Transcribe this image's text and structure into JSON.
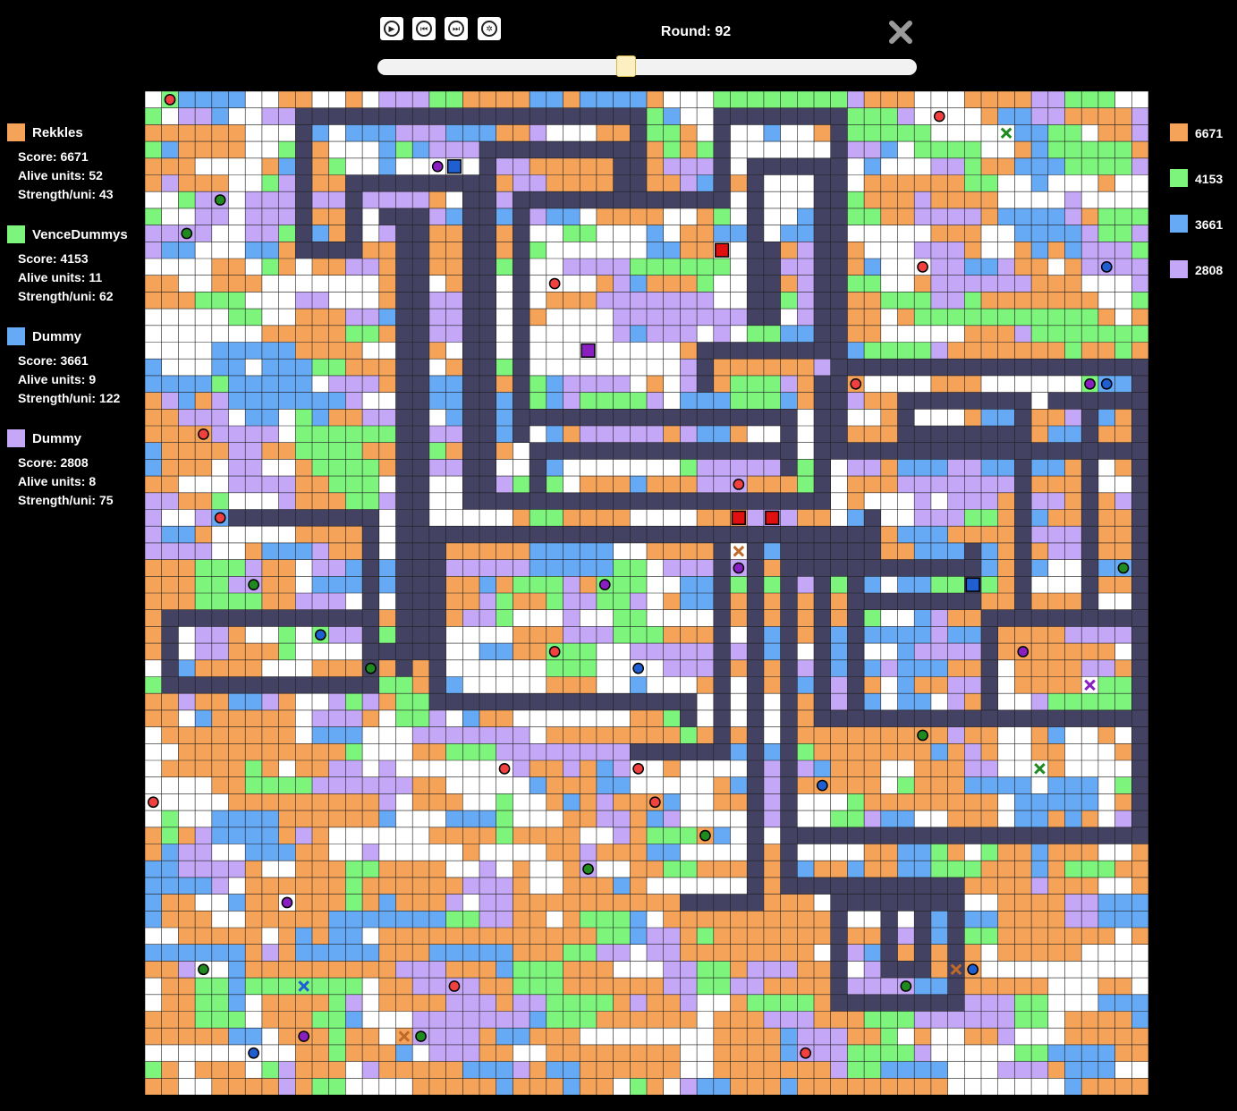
{
  "controls": [
    {
      "name": "play-button",
      "icon": "play-icon",
      "glyph": "▶"
    },
    {
      "name": "step-back-button",
      "icon": "rewind-icon",
      "glyph": "⏮"
    },
    {
      "name": "step-forward-button",
      "icon": "fast-forward-icon",
      "glyph": "⏭"
    },
    {
      "name": "settings-button",
      "icon": "gear-icon",
      "glyph": "✲"
    }
  ],
  "round_label": "Round: 92",
  "timeline": {
    "position_fraction": 0.46
  },
  "close_icon": "close-icon",
  "colors": {
    "orange": "#f6a35a",
    "green": "#7df57c",
    "blue": "#66a9f5",
    "purple": "#c4a7f7",
    "wall": "#434262",
    "empty": "#ffffff",
    "grid": "#1f1f1f"
  },
  "players": [
    {
      "name": "Rekkles",
      "color": "#f6a35a",
      "score": "Score: 6671",
      "alive": "Alive units: 52",
      "strength": "Strength/uni: 43"
    },
    {
      "name": "VenceDummys",
      "color": "#7df57c",
      "score": "Score: 4153",
      "alive": "Alive units: 11",
      "strength": "Strength/uni: 62"
    },
    {
      "name": "Dummy",
      "color": "#66a9f5",
      "score": "Score: 3661",
      "alive": "Alive units: 9",
      "strength": "Strength/uni: 122"
    },
    {
      "name": "Dummy",
      "color": "#c4a7f7",
      "score": "Score: 2808",
      "alive": "Alive units: 8",
      "strength": "Strength/uni: 75"
    }
  ],
  "scoreboard": [
    {
      "color": "#f6a35a",
      "value": "6671"
    },
    {
      "color": "#7df57c",
      "value": "4153"
    },
    {
      "color": "#66a9f5",
      "value": "3661"
    },
    {
      "color": "#c4a7f7",
      "value": "2808"
    }
  ],
  "board": {
    "grid_size": 60,
    "seed": 92,
    "walls": [
      [
        9,
        1,
        29,
        1
      ],
      [
        9,
        1,
        9,
        9
      ],
      [
        9,
        9,
        12,
        9
      ],
      [
        12,
        5,
        12,
        9
      ],
      [
        12,
        5,
        19,
        5
      ],
      [
        19,
        5,
        19,
        24
      ],
      [
        20,
        3,
        20,
        24
      ],
      [
        20,
        3,
        28,
        3
      ],
      [
        28,
        3,
        28,
        6
      ],
      [
        29,
        1,
        29,
        6
      ],
      [
        29,
        6,
        34,
        6
      ],
      [
        34,
        1,
        34,
        6
      ],
      [
        34,
        1,
        41,
        1
      ],
      [
        41,
        1,
        41,
        16
      ],
      [
        41,
        16,
        59,
        16
      ],
      [
        59,
        16,
        59,
        44
      ],
      [
        36,
        4,
        40,
        4
      ],
      [
        36,
        4,
        36,
        13
      ],
      [
        37,
        9,
        37,
        13
      ],
      [
        40,
        4,
        40,
        15
      ],
      [
        33,
        15,
        40,
        15
      ],
      [
        33,
        15,
        33,
        17
      ],
      [
        22,
        6,
        22,
        20
      ],
      [
        22,
        6,
        27,
        6
      ],
      [
        22,
        19,
        38,
        19
      ],
      [
        38,
        19,
        38,
        22
      ],
      [
        23,
        21,
        38,
        21
      ],
      [
        23,
        21,
        23,
        24
      ],
      [
        20,
        24,
        40,
        24
      ],
      [
        40,
        17,
        40,
        24
      ],
      [
        15,
        7,
        15,
        34
      ],
      [
        14,
        7,
        16,
        7
      ],
      [
        16,
        7,
        16,
        33
      ],
      [
        13,
        33,
        16,
        33
      ],
      [
        13,
        33,
        13,
        35
      ],
      [
        1,
        31,
        13,
        31
      ],
      [
        1,
        31,
        1,
        35
      ],
      [
        1,
        35,
        13,
        35
      ],
      [
        5,
        25,
        13,
        25
      ],
      [
        13,
        25,
        13,
        32
      ],
      [
        17,
        26,
        17,
        36
      ],
      [
        17,
        26,
        43,
        26
      ],
      [
        17,
        36,
        32,
        36
      ],
      [
        32,
        36,
        32,
        37
      ],
      [
        34,
        26,
        34,
        39
      ],
      [
        29,
        39,
        34,
        39
      ],
      [
        36,
        26,
        36,
        48
      ],
      [
        32,
        48,
        36,
        48
      ],
      [
        43,
        25,
        43,
        26
      ],
      [
        38,
        26,
        38,
        47
      ],
      [
        38,
        27,
        43,
        27
      ],
      [
        43,
        26,
        43,
        28
      ],
      [
        39,
        28,
        48,
        28
      ],
      [
        40,
        29,
        40,
        37
      ],
      [
        40,
        37,
        59,
        37
      ],
      [
        59,
        37,
        59,
        44
      ],
      [
        38,
        44,
        59,
        44
      ],
      [
        38,
        47,
        48,
        47
      ],
      [
        48,
        47,
        48,
        54
      ],
      [
        41,
        48,
        41,
        54
      ],
      [
        41,
        54,
        48,
        54
      ],
      [
        42,
        48,
        47,
        48
      ],
      [
        46,
        49,
        46,
        52
      ],
      [
        44,
        52,
        46,
        52
      ],
      [
        44,
        49,
        44,
        52
      ],
      [
        42,
        27,
        42,
        36
      ],
      [
        49,
        27,
        49,
        30
      ],
      [
        42,
        30,
        49,
        30
      ],
      [
        56,
        18,
        56,
        31
      ],
      [
        54,
        18,
        59,
        18
      ],
      [
        52,
        18,
        52,
        31
      ],
      [
        45,
        18,
        52,
        18
      ],
      [
        45,
        20,
        52,
        20
      ],
      [
        45,
        18,
        45,
        20
      ],
      [
        55,
        31,
        59,
        31
      ],
      [
        50,
        31,
        55,
        31
      ],
      [
        50,
        31,
        50,
        36
      ],
      [
        41,
        17,
        41,
        21
      ],
      [
        41,
        21,
        59,
        21
      ],
      [
        56,
        31,
        59,
        31
      ]
    ],
    "units": [
      {
        "x": 1,
        "y": 0,
        "color": "#f04040",
        "border": "#000"
      },
      {
        "x": 47,
        "y": 1,
        "color": "#f04040",
        "border": "#000"
      },
      {
        "x": 17,
        "y": 4,
        "color": "#8a1fc1",
        "border": "#c4a7f7"
      },
      {
        "x": 4,
        "y": 6,
        "color": "#1f8a1f",
        "border": "#7df57c"
      },
      {
        "x": 2,
        "y": 8,
        "color": "#1f8a1f",
        "border": "#7df57c"
      },
      {
        "x": 46,
        "y": 10,
        "color": "#f04040",
        "border": "#000"
      },
      {
        "x": 57,
        "y": 10,
        "color": "#1f5fd1",
        "border": "#66a9f5"
      },
      {
        "x": 24,
        "y": 11,
        "color": "#f04040",
        "border": "#000"
      },
      {
        "x": 42,
        "y": 17,
        "color": "#f04040",
        "border": "#000"
      },
      {
        "x": 56,
        "y": 17,
        "color": "#8a1fc1",
        "border": "#c4a7f7"
      },
      {
        "x": 57,
        "y": 17,
        "color": "#1f5fd1",
        "border": "#66a9f5"
      },
      {
        "x": 3,
        "y": 20,
        "color": "#f04040",
        "border": "#000"
      },
      {
        "x": 35,
        "y": 23,
        "color": "#f04040",
        "border": "#000"
      },
      {
        "x": 4,
        "y": 25,
        "color": "#f04040",
        "border": "#000"
      },
      {
        "x": 35,
        "y": 28,
        "color": "#8a1fc1",
        "border": "#c4a7f7"
      },
      {
        "x": 58,
        "y": 28,
        "color": "#1f8a1f",
        "border": "#7df57c"
      },
      {
        "x": 6,
        "y": 29,
        "color": "#1f8a1f",
        "border": "#7df57c"
      },
      {
        "x": 27,
        "y": 29,
        "color": "#8a1fc1",
        "border": "#c4a7f7"
      },
      {
        "x": 10,
        "y": 32,
        "color": "#1f5fd1",
        "border": "#66a9f5"
      },
      {
        "x": 24,
        "y": 33,
        "color": "#f04040",
        "border": "#000"
      },
      {
        "x": 52,
        "y": 33,
        "color": "#8a1fc1",
        "border": "#c4a7f7"
      },
      {
        "x": 13,
        "y": 34,
        "color": "#1f8a1f",
        "border": "#7df57c"
      },
      {
        "x": 29,
        "y": 34,
        "color": "#1f5fd1",
        "border": "#66a9f5"
      },
      {
        "x": 46,
        "y": 38,
        "color": "#1f8a1f",
        "border": "#7df57c"
      },
      {
        "x": 21,
        "y": 40,
        "color": "#f04040",
        "border": "#000"
      },
      {
        "x": 29,
        "y": 40,
        "color": "#f04040",
        "border": "#000"
      },
      {
        "x": 0,
        "y": 42,
        "color": "#f04040",
        "border": "#000"
      },
      {
        "x": 30,
        "y": 42,
        "color": "#f04040",
        "border": "#000"
      },
      {
        "x": 40,
        "y": 41,
        "color": "#1f5fd1",
        "border": "#66a9f5"
      },
      {
        "x": 33,
        "y": 44,
        "color": "#1f8a1f",
        "border": "#7df57c"
      },
      {
        "x": 26,
        "y": 46,
        "color": "#1f8a1f",
        "border": "#7df57c"
      },
      {
        "x": 8,
        "y": 48,
        "color": "#8a1fc1",
        "border": "#c4a7f7"
      },
      {
        "x": 3,
        "y": 52,
        "color": "#1f8a1f",
        "border": "#7df57c"
      },
      {
        "x": 49,
        "y": 52,
        "color": "#1f5fd1",
        "border": "#66a9f5"
      },
      {
        "x": 18,
        "y": 53,
        "color": "#f04040",
        "border": "#000"
      },
      {
        "x": 45,
        "y": 53,
        "color": "#1f8a1f",
        "border": "#7df57c"
      },
      {
        "x": 9,
        "y": 56,
        "color": "#8a1fc1",
        "border": "#c4a7f7"
      },
      {
        "x": 16,
        "y": 56,
        "color": "#1f8a1f",
        "border": "#7df57c"
      },
      {
        "x": 6,
        "y": 57,
        "color": "#1f5fd1",
        "border": "#66a9f5"
      },
      {
        "x": 39,
        "y": 57,
        "color": "#f04040",
        "border": "#000"
      }
    ],
    "bases": [
      {
        "x": 18,
        "y": 4,
        "color": "#1f5fd1"
      },
      {
        "x": 34,
        "y": 9,
        "color": "#e01010"
      },
      {
        "x": 26,
        "y": 15,
        "color": "#8a1fc1"
      },
      {
        "x": 35,
        "y": 25,
        "color": "#e01010"
      },
      {
        "x": 37,
        "y": 25,
        "color": "#e01010"
      },
      {
        "x": 49,
        "y": 29,
        "color": "#1f5fd1"
      }
    ],
    "crosses": [
      {
        "x": 51,
        "y": 2,
        "color": "#1f8a1f"
      },
      {
        "x": 35,
        "y": 27,
        "color": "#c06a2a"
      },
      {
        "x": 56,
        "y": 35,
        "color": "#8a1fc1"
      },
      {
        "x": 53,
        "y": 40,
        "color": "#1f8a1f"
      },
      {
        "x": 48,
        "y": 52,
        "color": "#c06a2a"
      },
      {
        "x": 9,
        "y": 53,
        "color": "#1f5fd1"
      },
      {
        "x": 15,
        "y": 56,
        "color": "#c06a2a"
      }
    ]
  }
}
